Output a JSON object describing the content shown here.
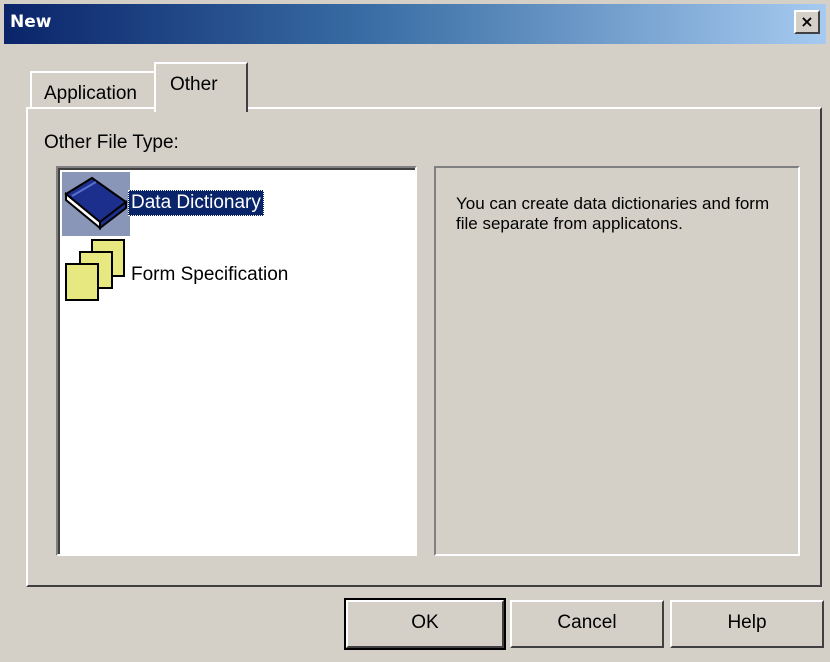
{
  "window": {
    "title": "New",
    "close_label": "×"
  },
  "tabs": [
    {
      "label": "Application",
      "selected": false
    },
    {
      "label": "Other",
      "selected": true
    }
  ],
  "group": {
    "label": "Other File Type:"
  },
  "list": {
    "items": [
      {
        "label": "Data Dictionary",
        "icon": "book-icon",
        "selected": true
      },
      {
        "label": "Form Specification",
        "icon": "form-pages-icon",
        "selected": false
      }
    ]
  },
  "description": "You can create data dictionaries and form file separate from applicatons.",
  "buttons": {
    "ok": "OK",
    "cancel": "Cancel",
    "help": "Help"
  },
  "colors": {
    "face": "#d4d0c8",
    "title_start": "#0a246a",
    "title_end": "#a6caf0",
    "selection": "#0a246a",
    "form_icon_fill": "#e8e880"
  }
}
